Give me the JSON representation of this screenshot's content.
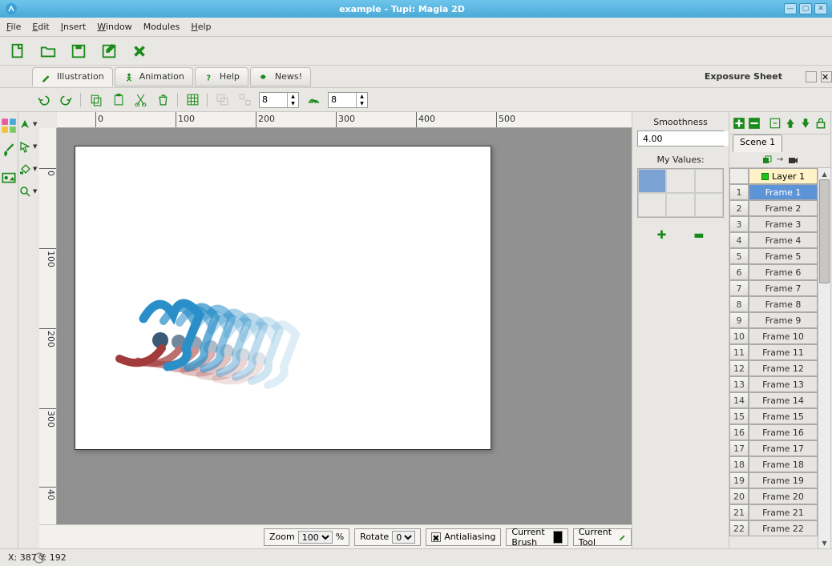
{
  "window": {
    "title": "example - Tupi: Magia 2D"
  },
  "menu": {
    "file": "File",
    "edit": "Edit",
    "insert": "Insert",
    "window": "Window",
    "modules": "Modules",
    "help": "Help"
  },
  "tabs": {
    "illustration": "Illustration",
    "animation": "Animation",
    "help": "Help",
    "news": "News!"
  },
  "exposure": {
    "title": "Exposure Sheet",
    "scene_tab": "Scene 1",
    "layer": "Layer 1",
    "frames": [
      "Frame 1",
      "Frame 2",
      "Frame 3",
      "Frame 4",
      "Frame 5",
      "Frame 6",
      "Frame 7",
      "Frame 8",
      "Frame 9",
      "Frame 10",
      "Frame 11",
      "Frame 12",
      "Frame 13",
      "Frame 14",
      "Frame 15",
      "Frame 16",
      "Frame 17",
      "Frame 18",
      "Frame 19",
      "Frame 20",
      "Frame 21",
      "Frame 22"
    ],
    "selected_frame": 0
  },
  "edit_toolbar": {
    "spin1": "8",
    "spin2": "8"
  },
  "sidepanel": {
    "smoothness_label": "Smoothness",
    "smoothness_value": "4.00",
    "values_label": "My Values:"
  },
  "bottom": {
    "zoom_label": "Zoom",
    "zoom_value": "100",
    "zoom_pct": "%",
    "rotate_label": "Rotate",
    "rotate_value": "0",
    "aa": "Antialiasing",
    "brush": "Current Brush",
    "tool": "Current Tool"
  },
  "status": {
    "coords": "X: 387 Y: 192"
  },
  "ruler": {
    "h": [
      "0",
      "100",
      "200",
      "300",
      "400",
      "500"
    ],
    "v": [
      "0",
      "100",
      "200",
      "300",
      "40"
    ]
  },
  "colors": {
    "accent": "#1a8a1a",
    "highlight": "#5d94d8"
  }
}
